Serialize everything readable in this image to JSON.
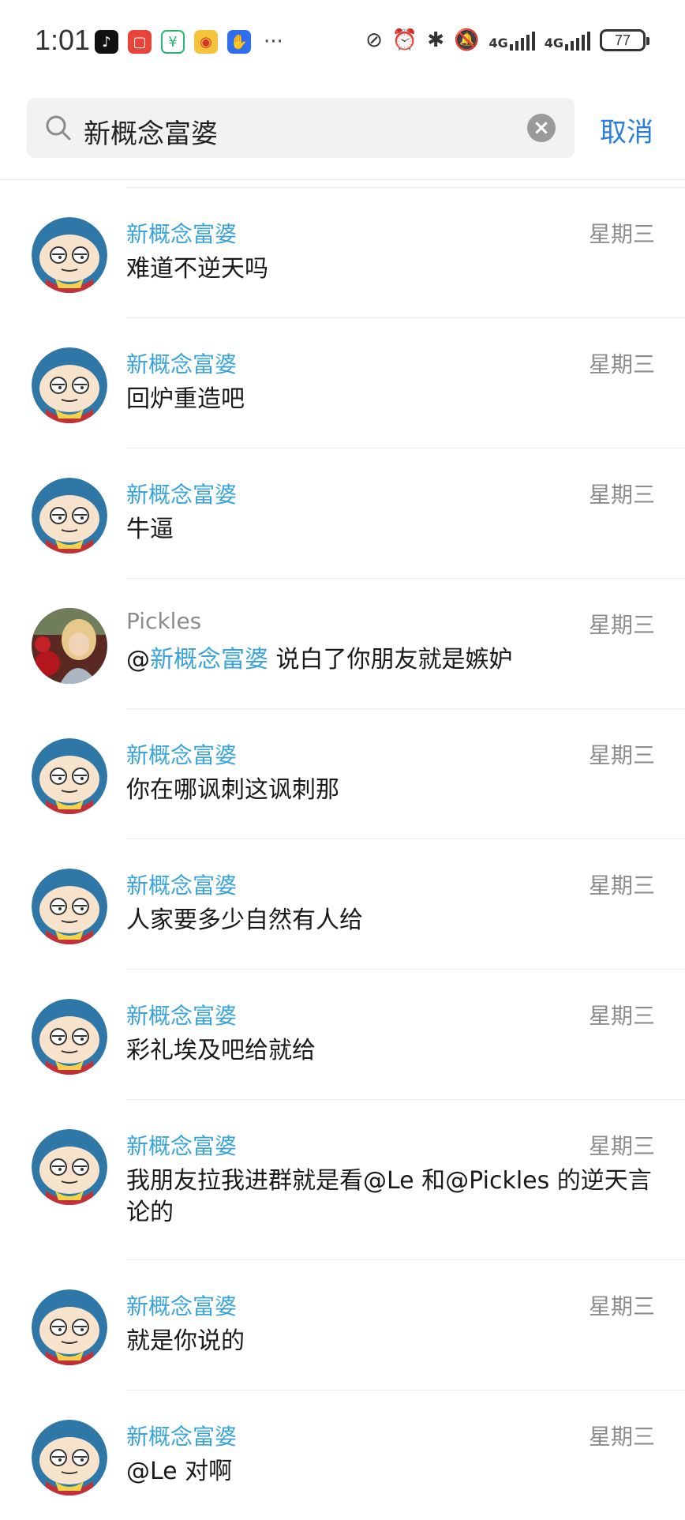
{
  "status_bar": {
    "time": "1:01",
    "app_icons": [
      "tiktok-icon",
      "red-app-icon",
      "green-app-icon",
      "weibo-icon",
      "blue-app-icon"
    ],
    "more": "···",
    "network_1": "4G",
    "network_2": "4G",
    "battery": "77"
  },
  "search": {
    "query": "新概念富婆",
    "cancel_label": "取消"
  },
  "results": [
    {
      "sender": "新概念富婆",
      "date": "星期三",
      "message": "难道不逆天吗",
      "avatar": "cartoon"
    },
    {
      "sender": "新概念富婆",
      "date": "星期三",
      "message": "回炉重造吧",
      "avatar": "cartoon"
    },
    {
      "sender": "新概念富婆",
      "date": "星期三",
      "message": "牛逼",
      "avatar": "cartoon"
    },
    {
      "sender": "Pickles",
      "date": "星期三",
      "mention_prefix": "@",
      "mention_name": "新概念富婆",
      "message": "说白了你朋友就是嫉妒",
      "avatar": "photo"
    },
    {
      "sender": "新概念富婆",
      "date": "星期三",
      "message": "你在哪讽刺这讽刺那",
      "avatar": "cartoon"
    },
    {
      "sender": "新概念富婆",
      "date": "星期三",
      "message": "人家要多少自然有人给",
      "avatar": "cartoon"
    },
    {
      "sender": "新概念富婆",
      "date": "星期三",
      "message": "彩礼埃及吧给就给",
      "avatar": "cartoon"
    },
    {
      "sender": "新概念富婆",
      "date": "星期三",
      "message": "我朋友拉我进群就是看@Le 和@Pickles 的逆天言论的",
      "avatar": "cartoon"
    },
    {
      "sender": "新概念富婆",
      "date": "星期三",
      "message": "就是你说的",
      "avatar": "cartoon"
    },
    {
      "sender": "新概念富婆",
      "date": "星期三",
      "message": "@Le 对啊",
      "avatar": "cartoon"
    }
  ],
  "colors": {
    "accent": "#2a7ed8",
    "name_blue": "#3aa3d8",
    "grey_text": "#8c8c8c"
  }
}
